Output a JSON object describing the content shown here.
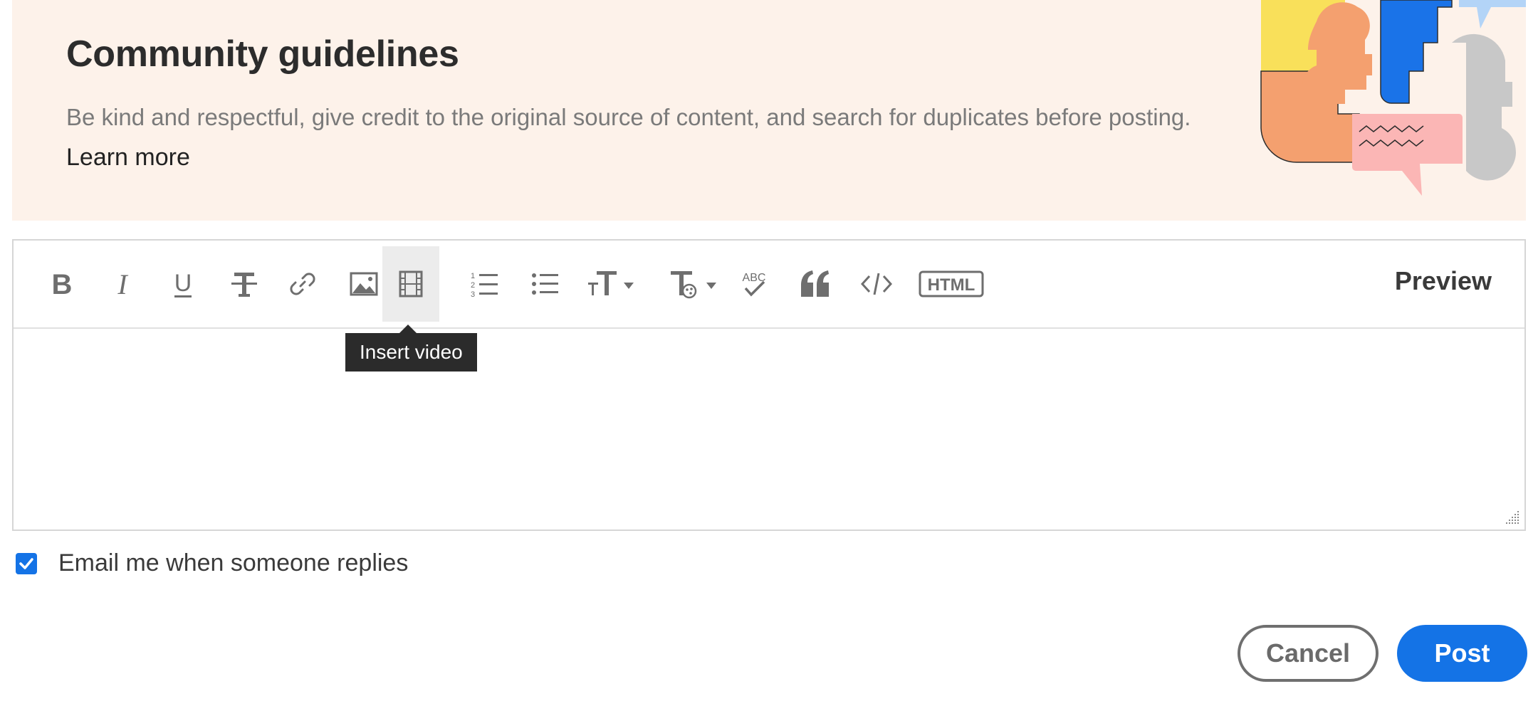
{
  "guidelines": {
    "title": "Community guidelines",
    "description": "Be kind and respectful, give credit to the original source of content, and search for duplicates before posting.",
    "learn_more": "Learn more",
    "background_color": "#fdf2ea"
  },
  "editor": {
    "toolbar": {
      "tools": [
        {
          "name": "bold",
          "icon": "bold-icon"
        },
        {
          "name": "italic",
          "icon": "italic-icon"
        },
        {
          "name": "underline",
          "icon": "underline-icon"
        },
        {
          "name": "strikethrough",
          "icon": "strikethrough-icon"
        },
        {
          "name": "link",
          "icon": "link-icon"
        },
        {
          "name": "insert-image",
          "icon": "image-icon"
        },
        {
          "name": "insert-video",
          "icon": "film-icon",
          "active": true
        },
        {
          "name": "numbered-list",
          "icon": "numbered-list-icon"
        },
        {
          "name": "bulleted-list",
          "icon": "bulleted-list-icon"
        },
        {
          "name": "font-size",
          "icon": "text-size-icon"
        },
        {
          "name": "text-style",
          "icon": "text-style-icon"
        },
        {
          "name": "spell-check",
          "icon": "spellcheck-icon"
        },
        {
          "name": "quote",
          "icon": "quote-icon"
        },
        {
          "name": "code",
          "icon": "code-icon"
        },
        {
          "name": "html",
          "icon": "html-icon",
          "label": "HTML"
        }
      ],
      "preview_label": "Preview"
    },
    "tooltip": "Insert video",
    "body": ""
  },
  "email_option": {
    "label": "Email me when someone replies",
    "checked": true
  },
  "actions": {
    "cancel_label": "Cancel",
    "post_label": "Post",
    "primary_color": "#1473e6"
  }
}
